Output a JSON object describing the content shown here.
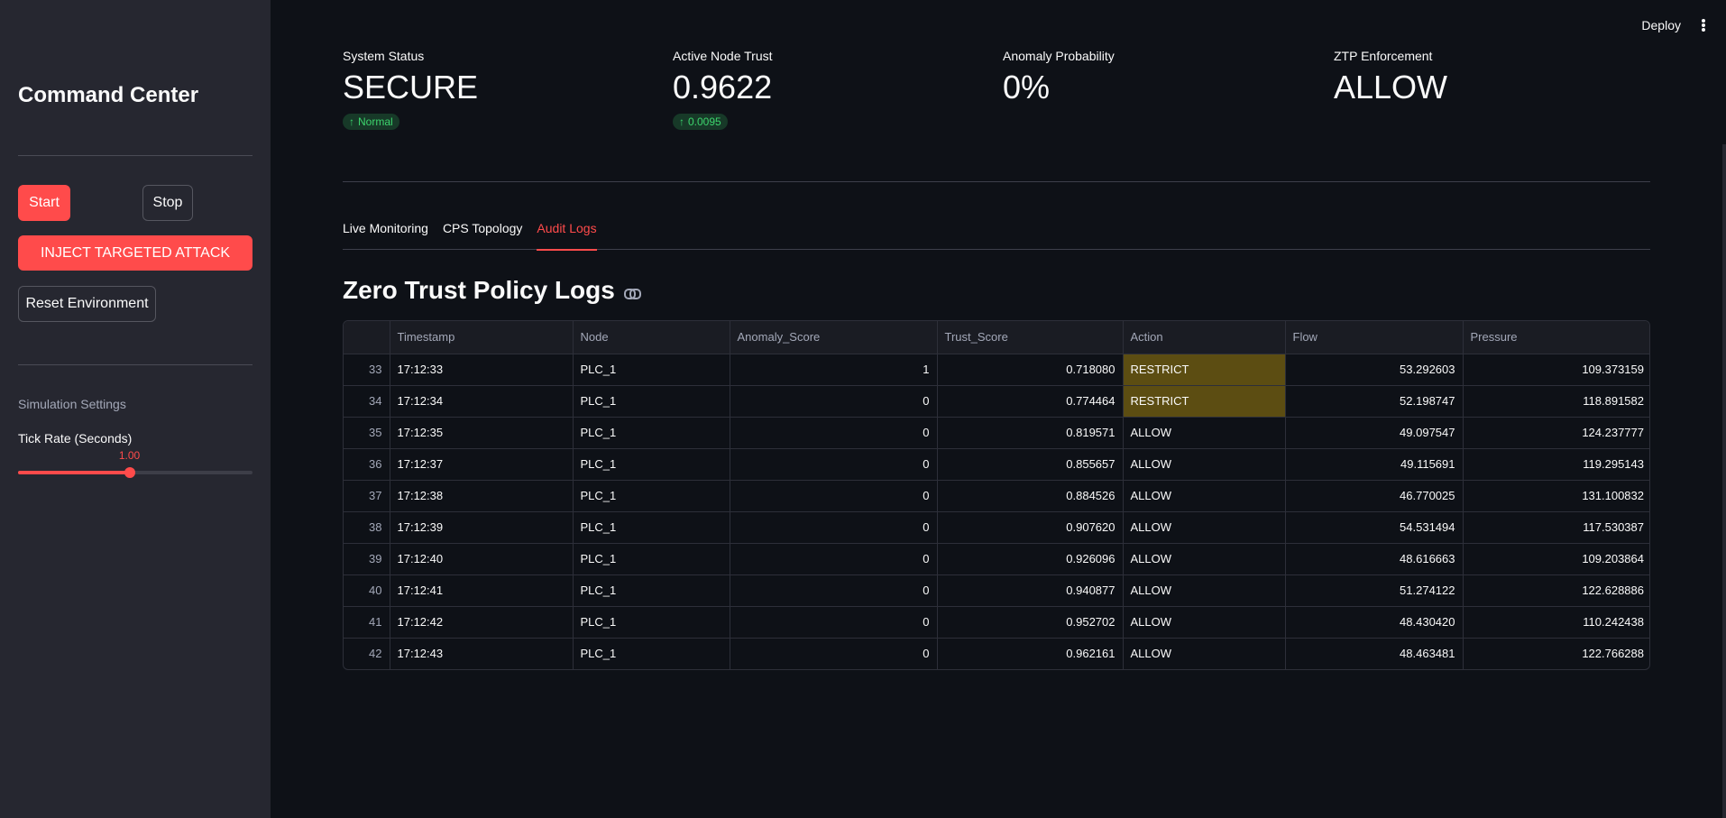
{
  "header": {
    "deploy_label": "Deploy",
    "menu_icon": "more-vertical-icon"
  },
  "sidebar": {
    "title": "Command Center",
    "start_label": "Start",
    "stop_label": "Stop",
    "inject_label": "INJECT TARGETED ATTACK",
    "reset_label": "Reset Environment",
    "settings_label": "Simulation Settings",
    "tick_rate_label": "Tick Rate (Seconds)",
    "tick_rate_value": "1.00",
    "tick_rate_fraction": 0.475
  },
  "metrics": [
    {
      "label": "System Status",
      "value": "SECURE",
      "delta": "Normal"
    },
    {
      "label": "Active Node Trust",
      "value": "0.9622",
      "delta": "0.0095"
    },
    {
      "label": "Anomaly Probability",
      "value": "0%",
      "delta": null
    },
    {
      "label": "ZTP Enforcement",
      "value": "ALLOW",
      "delta": null
    }
  ],
  "tabs": [
    {
      "label": "Live Monitoring",
      "active": false
    },
    {
      "label": "CPS Topology",
      "active": false
    },
    {
      "label": "Audit Logs",
      "active": true
    }
  ],
  "section_title": "Zero Trust Policy Logs",
  "table": {
    "columns": [
      "",
      "Timestamp",
      "Node",
      "Anomaly_Score",
      "Trust_Score",
      "Action",
      "Flow",
      "Pressure"
    ],
    "rows": [
      [
        "33",
        "17:12:33",
        "PLC_1",
        "1",
        "0.718080",
        "RESTRICT",
        "53.292603",
        "109.373159"
      ],
      [
        "34",
        "17:12:34",
        "PLC_1",
        "0",
        "0.774464",
        "RESTRICT",
        "52.198747",
        "118.891582"
      ],
      [
        "35",
        "17:12:35",
        "PLC_1",
        "0",
        "0.819571",
        "ALLOW",
        "49.097547",
        "124.237777"
      ],
      [
        "36",
        "17:12:37",
        "PLC_1",
        "0",
        "0.855657",
        "ALLOW",
        "49.115691",
        "119.295143"
      ],
      [
        "37",
        "17:12:38",
        "PLC_1",
        "0",
        "0.884526",
        "ALLOW",
        "46.770025",
        "131.100832"
      ],
      [
        "38",
        "17:12:39",
        "PLC_1",
        "0",
        "0.907620",
        "ALLOW",
        "54.531494",
        "117.530387"
      ],
      [
        "39",
        "17:12:40",
        "PLC_1",
        "0",
        "0.926096",
        "ALLOW",
        "48.616663",
        "109.203864"
      ],
      [
        "40",
        "17:12:41",
        "PLC_1",
        "0",
        "0.940877",
        "ALLOW",
        "51.274122",
        "122.628886"
      ],
      [
        "41",
        "17:12:42",
        "PLC_1",
        "0",
        "0.952702",
        "ALLOW",
        "48.430420",
        "110.242438"
      ],
      [
        "42",
        "17:12:43",
        "PLC_1",
        "0",
        "0.962161",
        "ALLOW",
        "48.463481",
        "122.766288"
      ]
    ]
  },
  "colors": {
    "accent": "#ff4b4b",
    "background": "#0e1117",
    "sidebar": "#262730",
    "restrict_highlight": "#5c4d12",
    "delta_positive": "#3dd56d"
  }
}
